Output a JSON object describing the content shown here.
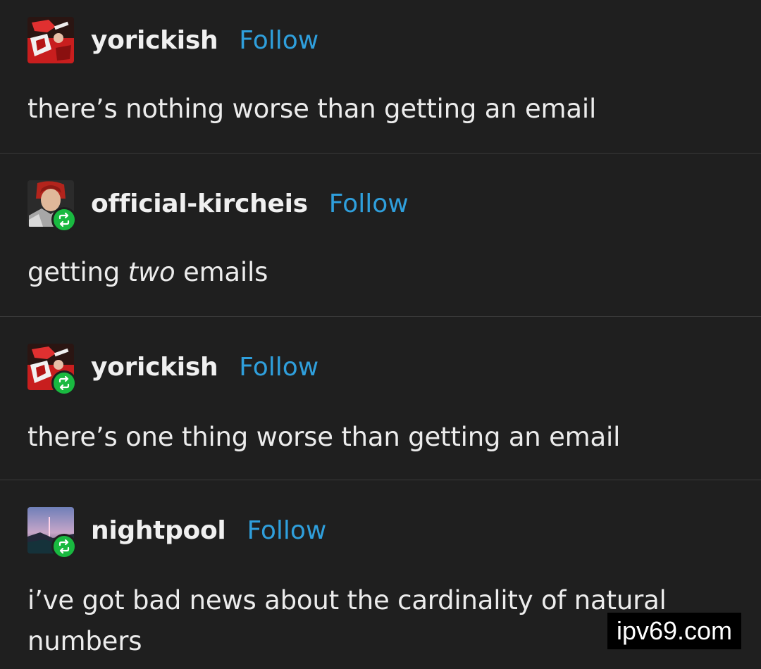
{
  "posts": [
    {
      "username": "yorickish",
      "follow_label": "Follow",
      "text": "there’s nothing worse than getting an email",
      "avatar_icon": "red-haired-figure-avatar",
      "reblog_icon": null
    },
    {
      "username": "official-kircheis",
      "follow_label": "Follow",
      "text_before": "getting ",
      "text_em": "two",
      "text_after": " emails",
      "avatar_icon": "red-haired-knight-avatar",
      "reblog_icon": "reblog-icon"
    },
    {
      "username": "yorickish",
      "follow_label": "Follow",
      "text": "there’s one thing worse than getting an email",
      "avatar_icon": "red-haired-figure-avatar",
      "reblog_icon": "reblog-icon"
    },
    {
      "username": "nightpool",
      "follow_label": "Follow",
      "text_line1": "i’ve got bad news about the cardinality of natural",
      "text_line2": "numbers",
      "avatar_icon": "night-landscape-avatar",
      "reblog_icon": "reblog-icon"
    }
  ],
  "watermark": "ipv69.com",
  "colors": {
    "background": "#1f1f1f",
    "follow": "#2f9fdc",
    "reblog_badge": "#19b940",
    "divider": "#3a3a3a"
  }
}
